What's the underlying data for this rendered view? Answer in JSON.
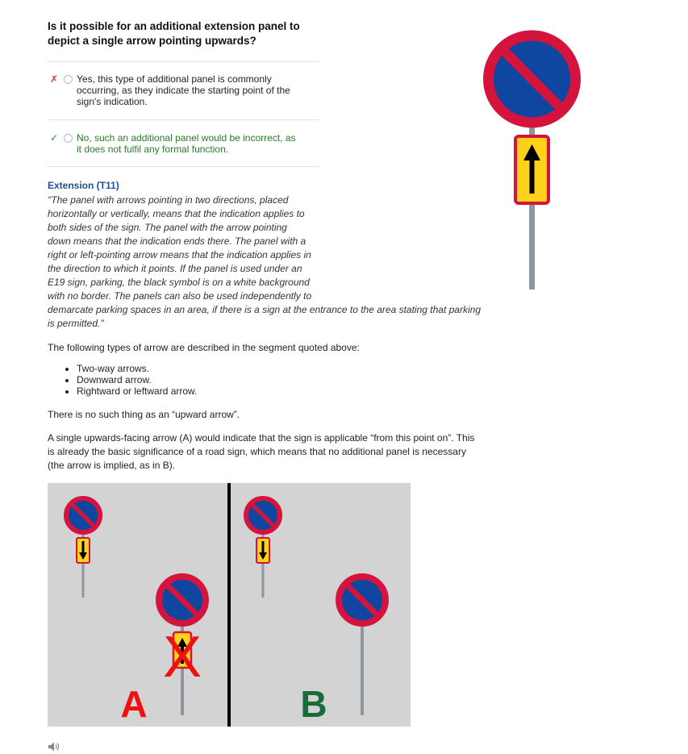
{
  "question": {
    "line1": "Is it possible for an additional extension panel to",
    "line2": "depict a single arrow pointing upwards?"
  },
  "answers": [
    {
      "mark": "✗",
      "lines": [
        "Yes, this type of additional panel is commonly",
        "occurring, as they indicate the starting point of the",
        "sign's indication."
      ],
      "status": "wrong"
    },
    {
      "mark": "✓",
      "lines": [
        "No, such an additional panel would be incorrect, as",
        "it does not fulfil any formal function."
      ],
      "status": "correct"
    }
  ],
  "extension": {
    "title": "Extension (T11)",
    "quote_lines": [
      "\"The panel with arrows pointing in two directions, placed",
      "horizontally or vertically, means that the indication applies to",
      "both sides of the sign. The panel with the arrow pointing",
      "down means that the indication ends there. The panel with a",
      "right or left-pointing arrow means that the indication applies in",
      "the direction to which it points. If the panel is used under an",
      "E19 sign, parking, the black symbol is on a white background",
      "with no border. The panels can also be used independently to",
      "demarcate parking spaces in an area, if there is a sign at the entrance to the area stating that parking",
      "is permitted.\""
    ]
  },
  "intro_text": "The following types of arrow are described in the segment quoted above:",
  "arrow_types": [
    "Two-way arrows.",
    "Downward arrow.",
    "Rightward or leftward arrow."
  ],
  "no_upward_text": "There is no such thing as an “upward arrow”.",
  "explanation_lines": [
    "A single upwards-facing arrow (A) would indicate that the sign is applicable “from this point on”. This",
    "is already the basic significance of a road sign, which means that no additional panel is necessary",
    "(the arrow is implied, as in B)."
  ],
  "figure": {
    "label_a": "A",
    "label_b": "B",
    "label_a_color": "#ee1111",
    "label_b_color": "#1a6b3a",
    "cross_symbol": "X"
  },
  "colors": {
    "sign_red": "#d4143c",
    "sign_blue": "#0f47a0",
    "panel_yellow": "#ffd21a",
    "pole_gray": "#8e979e",
    "title_blue": "#1e4f8f"
  },
  "icons": {
    "sound": "speaker-icon"
  }
}
